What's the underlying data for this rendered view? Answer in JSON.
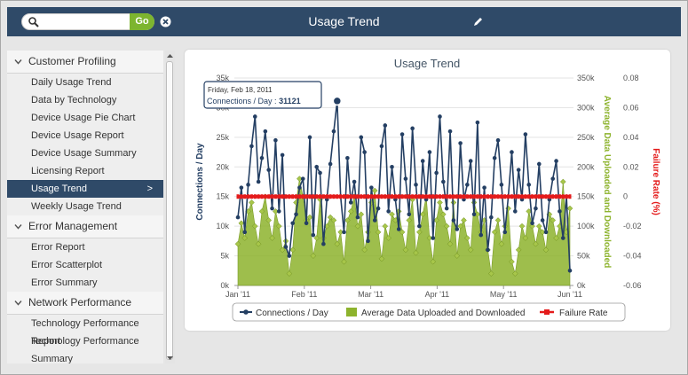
{
  "header": {
    "title": "Usage Trend",
    "search_value": "",
    "search_placeholder": "",
    "go_label": "Go"
  },
  "sidebar": {
    "sections": [
      {
        "label": "Customer Profiling",
        "items": [
          "Daily Usage Trend",
          "Data by Technology",
          "Device Usage Pie Chart",
          "Device Usage Report",
          "Device Usage Summary",
          "Licensing Report",
          "Usage Trend",
          "Weekly Usage Trend"
        ],
        "active": 6
      },
      {
        "label": "Error Management",
        "items": [
          "Error Report",
          "Error Scatterplot",
          "Error Summary"
        ],
        "active": -1
      },
      {
        "label": "Network Performance",
        "items": [
          "Technology Performance Report",
          "Technology Performance",
          "Summary"
        ],
        "active": -1
      }
    ],
    "active_marker": ">"
  },
  "colors": {
    "header_bg": "#2f4a68",
    "connections": "#243f63",
    "avg_data": "#8db32d",
    "failure": "#e41b1b"
  },
  "tooltip": {
    "date": "Friday, Feb 18, 2011",
    "label": "Connections / Day",
    "sep": " : ",
    "value": "31121"
  },
  "chart_data": {
    "type": "line",
    "title": "Usage Trend",
    "x_ticks": [
      "Jan '11",
      "Feb '11",
      "Mar '11",
      "Apr '11",
      "May '11",
      "Jun '11"
    ],
    "y_left": {
      "label": "Connections / Day",
      "ticks": [
        "0k",
        "5k",
        "10k",
        "15k",
        "20k",
        "25k",
        "30k",
        "35k"
      ],
      "range": [
        0,
        35000
      ]
    },
    "y_right1": {
      "label": "Average Data Uploaded and Downloaded",
      "ticks": [
        "0k",
        "50k",
        "100k",
        "150k",
        "200k",
        "250k",
        "300k",
        "350k"
      ],
      "range": [
        0,
        350000
      ]
    },
    "y_right2": {
      "label": "Failure Rate (%)",
      "ticks": [
        "-0.06",
        "-0.04",
        "-0.02",
        "0",
        "0.02",
        "0.04",
        "0.06",
        "0.08"
      ],
      "range": [
        -0.06,
        0.08
      ]
    },
    "legend": [
      "Connections / Day",
      "Average Data Uploaded and Downloaded",
      "Failure Rate"
    ],
    "series": [
      {
        "name": "Connections / Day",
        "axis": "left",
        "values": [
          11500,
          16500,
          9000,
          17000,
          23500,
          28500,
          17500,
          21500,
          26000,
          19500,
          13000,
          24500,
          12500,
          22000,
          6500,
          5000,
          10500,
          12000,
          16500,
          18000,
          10500,
          25000,
          8500,
          20000,
          19000,
          7000,
          14500,
          20500,
          26000,
          31121,
          15000,
          9000,
          21500,
          14000,
          17500,
          11500,
          25000,
          22500,
          7500,
          16500,
          11000,
          13000,
          23500,
          27000,
          12500,
          20000,
          14500,
          9500,
          25500,
          18000,
          12000,
          26500,
          17000,
          10000,
          21000,
          14500,
          22500,
          8000,
          19000,
          28500,
          17500,
          13000,
          26000,
          11000,
          9500,
          24000,
          14500,
          17000,
          21000,
          12000,
          27500,
          8500,
          16500,
          6000,
          11500,
          21500,
          24500,
          17000,
          9000,
          15000,
          22500,
          12500,
          19500,
          14500,
          25500,
          17000,
          10500,
          13000,
          20500,
          11000,
          9000,
          14500,
          18000,
          21000,
          12500,
          8000,
          15000,
          2500
        ]
      },
      {
        "name": "Average Data Uploaded and Downloaded",
        "axis": "right1",
        "values": [
          70000,
          105000,
          80000,
          125000,
          140000,
          100000,
          70000,
          125000,
          150000,
          110000,
          80000,
          125000,
          100000,
          60000,
          75000,
          20000,
          60000,
          140000,
          180000,
          150000,
          110000,
          115000,
          50000,
          80000,
          145000,
          80000,
          100000,
          115000,
          110000,
          70000,
          90000,
          40000,
          110000,
          125000,
          150000,
          100000,
          120000,
          60000,
          90000,
          140000,
          160000,
          90000,
          45000,
          100000,
          80000,
          120000,
          110000,
          125000,
          90000,
          60000,
          110000,
          145000,
          55000,
          90000,
          120000,
          150000,
          80000,
          40000,
          110000,
          140000,
          120000,
          100000,
          70000,
          140000,
          50000,
          100000,
          110000,
          80000,
          60000,
          140000,
          120000,
          90000,
          110000,
          60000,
          20000,
          90000,
          110000,
          70000,
          100000,
          130000,
          40000,
          20000,
          60000,
          100000,
          80000,
          125000,
          100000,
          70000,
          100000,
          90000,
          60000,
          120000,
          110000,
          80000,
          100000,
          175000,
          90000,
          130000
        ]
      },
      {
        "name": "Failure Rate",
        "axis": "right2",
        "values": [
          0,
          0,
          0,
          0,
          0,
          0,
          0,
          0,
          0,
          0,
          0,
          0,
          0,
          0,
          0,
          0,
          0,
          0,
          0,
          0,
          0,
          0,
          0,
          0,
          0,
          0,
          0,
          0,
          0,
          0,
          0,
          0,
          0,
          0,
          0,
          0,
          0,
          0,
          0,
          0,
          0,
          0,
          0,
          0,
          0,
          0,
          0,
          0,
          0,
          0,
          0,
          0,
          0,
          0,
          0,
          0,
          0,
          0,
          0,
          0,
          0,
          0,
          0,
          0,
          0,
          0,
          0,
          0,
          0,
          0,
          0,
          0,
          0,
          0,
          0,
          0,
          0,
          0,
          0,
          0,
          0,
          0,
          0,
          0,
          0,
          0,
          0,
          0,
          0,
          0,
          0,
          0,
          0,
          0,
          0,
          0,
          0,
          0
        ]
      }
    ],
    "grid": true,
    "legend_position": "bottom"
  }
}
